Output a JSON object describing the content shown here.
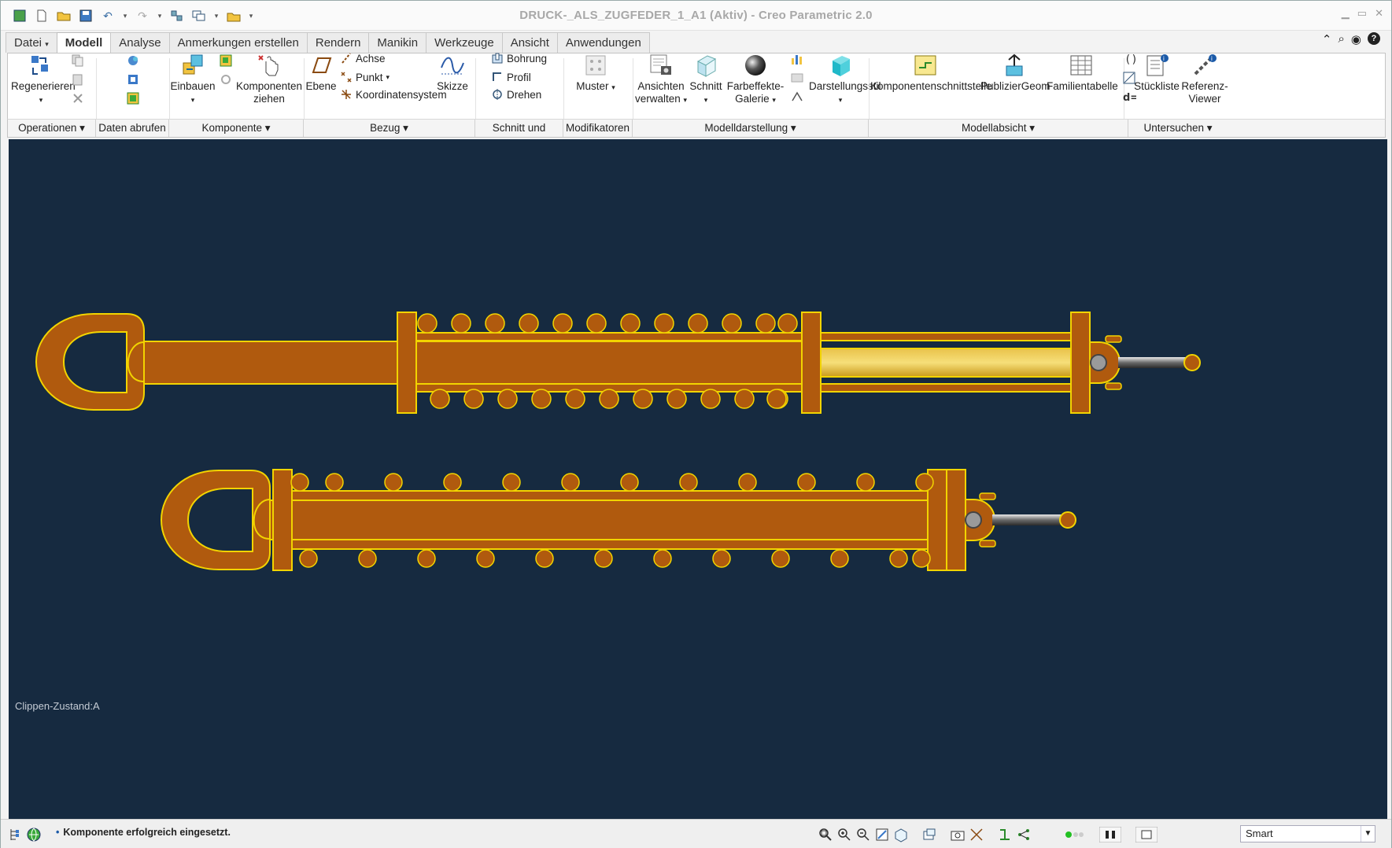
{
  "window": {
    "title": "DRUCK-_ALS_ZUGFEDER_1_A1 (Aktiv) - Creo Parametric 2.0"
  },
  "tabs": [
    {
      "label": "Datei",
      "active": false
    },
    {
      "label": "Modell",
      "active": true
    },
    {
      "label": "Analyse",
      "active": false
    },
    {
      "label": "Anmerkungen erstellen",
      "active": false
    },
    {
      "label": "Rendern",
      "active": false
    },
    {
      "label": "Manikin",
      "active": false
    },
    {
      "label": "Werkzeuge",
      "active": false
    },
    {
      "label": "Ansicht",
      "active": false
    },
    {
      "label": "Anwendungen",
      "active": false
    }
  ],
  "ribbon": {
    "regenerate": "Regenerieren",
    "assemble": "Einbauen",
    "drag_components": [
      "Komponenten",
      "ziehen"
    ],
    "plane": "Ebene",
    "axis": "Achse",
    "point": "Punkt",
    "csys": "Koordinatensystem",
    "sketch": "Skizze",
    "hole": "Bohrung",
    "profile": "Profil",
    "revolve": "Drehen",
    "pattern": "Muster",
    "manage_views": [
      "Ansichten",
      "verwalten"
    ],
    "section": "Schnitt",
    "appearance": [
      "Farbeffekte-",
      "Galerie"
    ],
    "display_style": "Darstellungsstil",
    "component_interface": "Komponentenschnittstelle",
    "publish_geom": "PublizierGeom",
    "family_table": "Familientabelle",
    "bom": "Stückliste",
    "ref_viewer": [
      "Referenz-",
      "Viewer"
    ]
  },
  "groups": [
    {
      "label": "Operationen"
    },
    {
      "label": "Daten abrufen"
    },
    {
      "label": "Komponente"
    },
    {
      "label": "Bezug"
    },
    {
      "label": "Schnitt und Fläche"
    },
    {
      "label": "Modifikatoren"
    },
    {
      "label": "Modelldarstellung"
    },
    {
      "label": "Modellabsicht"
    },
    {
      "label": "Untersuchen"
    }
  ],
  "viewport": {
    "clip_state": "Clippen-Zustand:A",
    "background": "#162a40",
    "part_color": "#b05a0e",
    "edge_color": "#f2d400"
  },
  "status": {
    "message": "Komponente erfolgreich eingesetzt.",
    "filter": "Smart"
  }
}
